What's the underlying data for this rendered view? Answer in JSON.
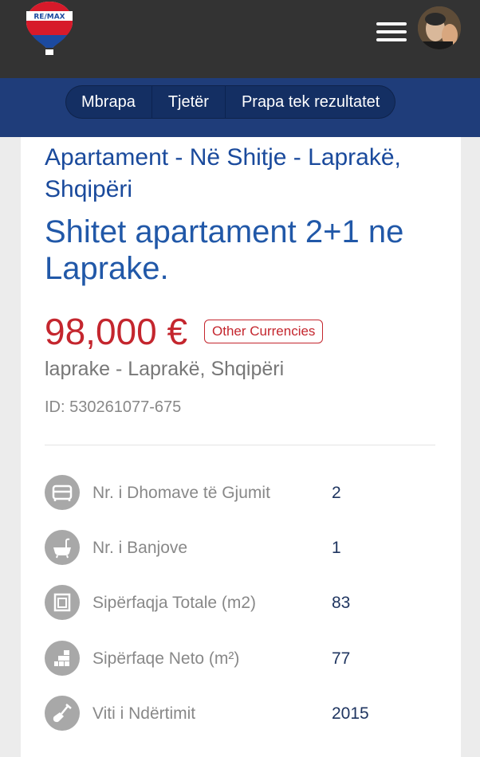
{
  "header": {
    "logo_text": "RE/MAX",
    "menu_icon": "hamburger-menu-icon",
    "avatar": "user-avatar"
  },
  "nav": {
    "back_label": "Mbrapa",
    "next_label": "Tjetër",
    "results_label": "Prapa tek rezultatet"
  },
  "listing": {
    "subtitle": "Apartament - Në Shitje - Laprakë, Shqipëri",
    "title": "Shitet apartament 2+1 ne Laprake.",
    "price": "98,000 €",
    "other_currencies_label": "Other Currencies",
    "location": "laprake - Laprakë, Shqipëri",
    "id": "ID: 530261077-675"
  },
  "features": [
    {
      "icon": "bed-icon",
      "label": "Nr. i Dhomave të Gjumit",
      "value": "2"
    },
    {
      "icon": "bathtub-icon",
      "label": "Nr. i Banjove",
      "value": "1"
    },
    {
      "icon": "total-area-icon",
      "label": "Sipërfaqja Totale (m2)",
      "value": "83"
    },
    {
      "icon": "net-area-icon",
      "label": "Sipërfaqe Neto (m²)",
      "value": "77"
    },
    {
      "icon": "shovel-icon",
      "label": "Viti i Ndërtimit",
      "value": "2015"
    }
  ],
  "colors": {
    "topbar": "#333333",
    "navband": "#1f3d7a",
    "title_blue": "#2158a8",
    "price_red": "#c4262e"
  }
}
